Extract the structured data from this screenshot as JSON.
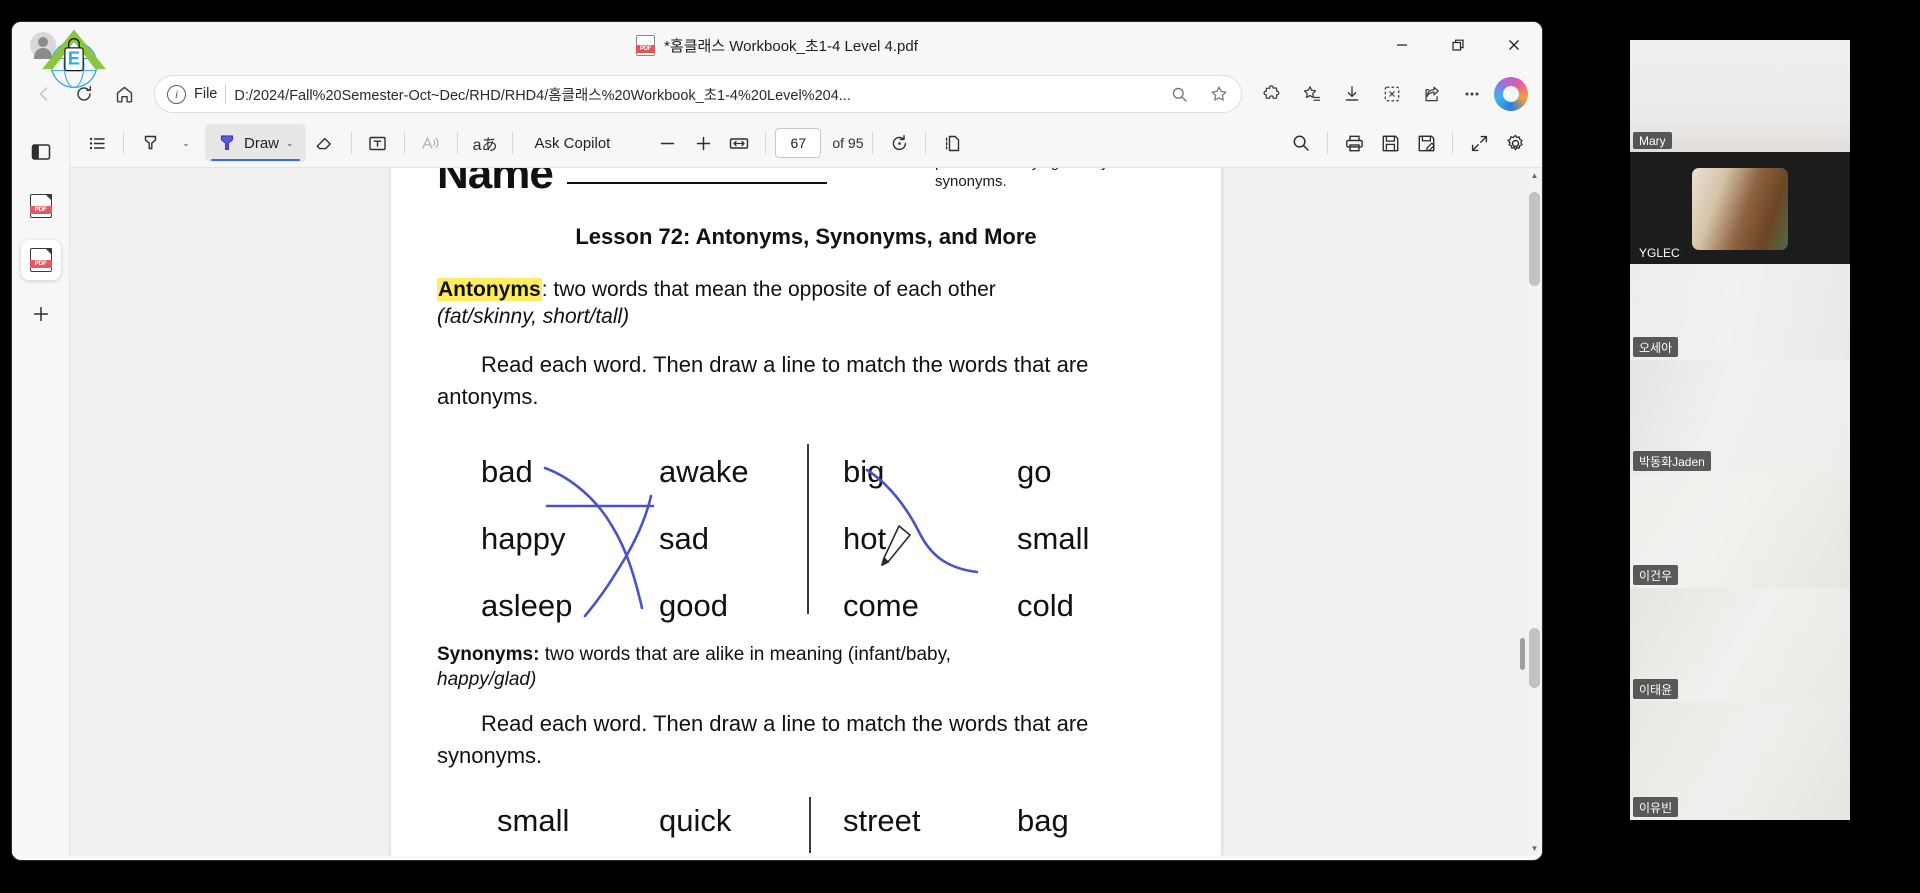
{
  "window": {
    "tab_title": "*홈클래스 Workbook_초1-4 Level 4.pdf",
    "minimize_label": "—",
    "restore_label": "❐",
    "close_label": "✕"
  },
  "navbar": {
    "back_icon": "back-arrow-icon",
    "refresh_icon": "refresh-icon",
    "home_icon": "home-icon",
    "file_label": "File",
    "url": "D:/2024/Fall%20Semester-Oct~Dec/RHD/RHD4/홈클래스%20Workbook_초1-4%20Level%204...",
    "zoom_icon": "magnifier-icon",
    "favorite_icon": "star-icon",
    "extensions_icon": "extensions-icon",
    "collections_icon": "collections-star-icon",
    "downloads_icon": "download-icon",
    "clip_icon": "screenshot-scissors-icon",
    "share_icon": "share-icon",
    "more_icon": "more-ellipsis-icon",
    "copilot_icon": "copilot-icon"
  },
  "app_sidebar": {
    "panel_toggle": "panel-toggle-icon",
    "tabs": [
      {
        "name": "pdf-tab-1",
        "active": false
      },
      {
        "name": "pdf-tab-2",
        "active": true
      }
    ],
    "add_label": "+"
  },
  "pdf_toolbar": {
    "list_icon": "bullet-list-icon",
    "highlighter_icon": "highlighter-icon",
    "highlighter_caret": "⌄",
    "draw_label": "Draw",
    "draw_caret": "⌄",
    "eraser_icon": "eraser-icon",
    "textbox_icon": "text-box-icon",
    "read_aloud_icon": "read-aloud-icon",
    "translate_icon": "aあ",
    "ask_copilot_label": "Ask Copilot",
    "zoom_out_label": "−",
    "zoom_in_label": "+",
    "fit_width_icon": "fit-to-width-icon",
    "current_page": "67",
    "page_total_label": "of 95",
    "rotate_icon": "rotate-icon",
    "page_view_icon": "page-view-icon",
    "search_icon": "search-icon",
    "print_icon": "print-icon",
    "save_icon": "save-icon",
    "save_as_icon": "save-as-icon",
    "fullscreen_icon": "fullscreen-icon",
    "settings_icon": "gear-icon",
    "accent_color": "#3b6fd4"
  },
  "document": {
    "name_label": "Name",
    "teacher_note": "practice identifying antonyms and synonyms.",
    "lesson_title": "Lesson 72: Antonyms, Synonyms, and More",
    "antonyms_term": "Antonyms",
    "antonyms_def": ": two words that mean the opposite of each other",
    "antonyms_examples": "(fat/skinny, short/tall)",
    "antonyms_instruction": "Read each word. Then draw a line to match the words that are antonyms.",
    "antonyms_groups": [
      {
        "left": [
          "bad",
          "happy",
          "asleep"
        ],
        "right": [
          "awake",
          "sad",
          "good"
        ]
      },
      {
        "left": [
          "big",
          "hot",
          "come"
        ],
        "right": [
          "go",
          "small",
          "cold"
        ]
      }
    ],
    "synonyms_term": "Synonyms:",
    "synonyms_def": " two words that are alike in meaning (infant/baby,",
    "synonyms_examples": "happy/glad)",
    "synonyms_instruction": "Read each word. Then draw a line to match the words that are synonyms.",
    "synonyms_groups": [
      {
        "left": [
          "small"
        ],
        "right": [
          "quick"
        ]
      },
      {
        "left": [
          "street"
        ],
        "right": [
          "bag"
        ]
      }
    ],
    "ink_color": "#4a52c8",
    "highlight_color": "#ffec62"
  },
  "video_panel": {
    "active_color": "#2ee07a",
    "participants": [
      {
        "name": "Mary",
        "active": false,
        "kind": "blank-bright"
      },
      {
        "name": "YGLEC",
        "active": false,
        "kind": "room-photo"
      },
      {
        "name": "오세아",
        "active": true,
        "kind": "blank-bright"
      },
      {
        "name": "박동화Jaden",
        "active": false,
        "kind": "blank-bright"
      },
      {
        "name": "이건우",
        "active": false,
        "kind": "blank-bright"
      },
      {
        "name": "이태윤",
        "active": false,
        "kind": "blank-bright"
      },
      {
        "name": "이유빈",
        "active": false,
        "kind": "blank-bright"
      }
    ]
  }
}
